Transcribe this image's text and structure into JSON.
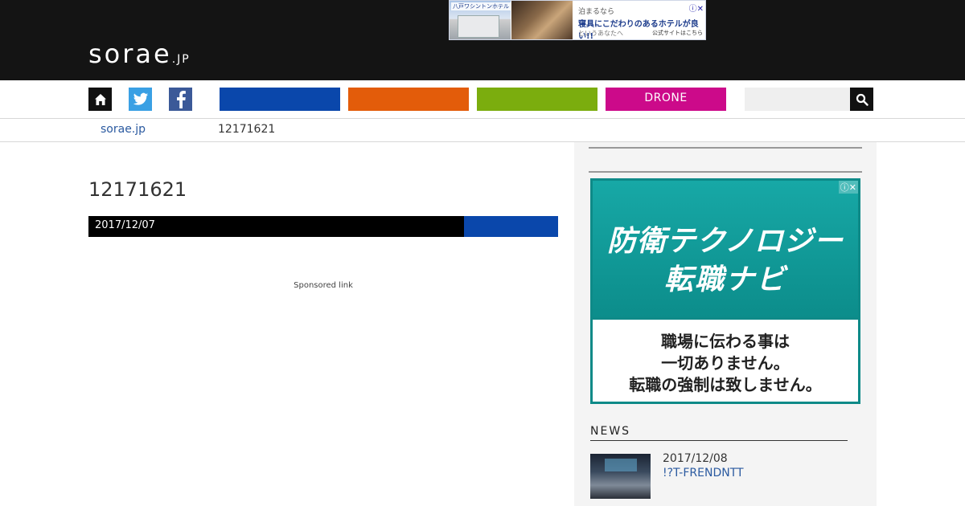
{
  "header": {
    "logo_main": "sorae",
    "logo_sub": ".JP",
    "top_ad": {
      "brand": "八戸ワシントンホテル",
      "line1": "泊まるなら",
      "line2": "寝具にこだわりのあるホテルが良い!!",
      "line3": "というあなたへ",
      "cta": "公式サイトはこちら",
      "adchoice": "ⓘ✕"
    }
  },
  "nav": {
    "categories": [
      "",
      "",
      "",
      "DRONE"
    ],
    "search_placeholder": ""
  },
  "breadcrumb": {
    "home": "sorae.jp",
    "current": "12171621"
  },
  "article": {
    "title": "12171621",
    "date": "2017/12/07",
    "sponsored": "Sponsored link"
  },
  "sidebar": {
    "ad": {
      "headline1": "防衛テクノロジー",
      "headline2": "転職ナビ",
      "body1": "職場に伝わる事は",
      "body2": "一切ありません。",
      "body3": "転職の強制は致しません。",
      "adchoice": "ⓘ✕"
    },
    "news": {
      "heading": "NEWS",
      "items": [
        {
          "date": "2017/12/08",
          "title": "!?T-FRENDNTT"
        }
      ]
    }
  },
  "colors": {
    "header_bg": "#141414",
    "nav_blue": "#0a47ab",
    "nav_orange": "#e35c0a",
    "nav_green": "#7bad0e",
    "nav_magenta": "#cc0a8a",
    "link": "#2b5aa0",
    "ad_teal": "#17a8a6"
  },
  "icons": [
    "home-icon",
    "twitter-icon",
    "facebook-icon",
    "search-icon",
    "adchoice-icon"
  ]
}
